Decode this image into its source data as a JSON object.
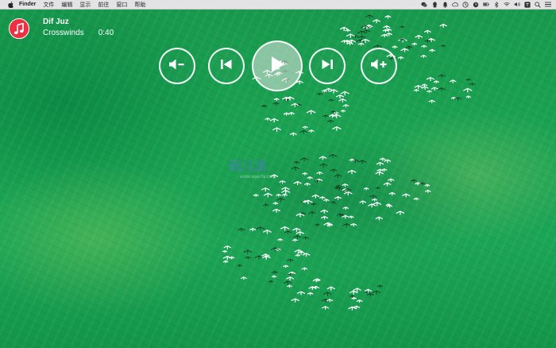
{
  "menubar": {
    "app_name": "Finder",
    "items": [
      "文件",
      "编辑",
      "显示",
      "前往",
      "窗口",
      "帮助"
    ],
    "status_icons": [
      "wechat-icon",
      "qq-icon",
      "bell-icon",
      "cloud-icon",
      "tm-icon",
      "clock-icon",
      "battery-icon",
      "bluetooth-icon",
      "wifi-icon",
      "volume-icon",
      "input-icon",
      "search-icon",
      "list-icon"
    ]
  },
  "now_playing": {
    "artist": "Dif Juz",
    "track": "Crosswinds",
    "time": "0:40",
    "app_icon": "music-note-icon",
    "app_icon_color": "#ef2f44"
  },
  "controls": {
    "volume_down": "volume-down-icon",
    "previous": "previous-track-icon",
    "play": "play-icon",
    "next": "next-track-icon",
    "volume_up": "volume-up-icon"
  },
  "watermark": {
    "text": "玩儿法",
    "sub": "www.waerfa.com"
  },
  "colors": {
    "background": "#1aa352",
    "control_stroke": "#ffffff"
  }
}
